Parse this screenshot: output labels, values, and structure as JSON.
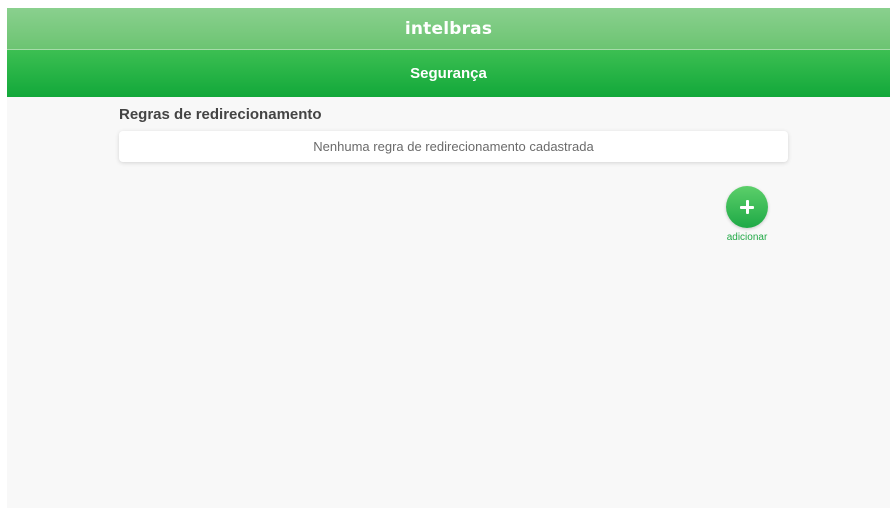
{
  "header": {
    "logo_text": "intelbras",
    "page_title": "Segurança"
  },
  "main": {
    "section_title": "Regras de redirecionamento",
    "empty_message": "Nenhuma regra de redirecionamento cadastrada",
    "add_button": {
      "icon": "plus-icon",
      "label": "adicionar"
    }
  },
  "colors": {
    "brand_green": "#1ea946",
    "header_light_green": "#7fcc85",
    "background": "#f8f8f8"
  }
}
